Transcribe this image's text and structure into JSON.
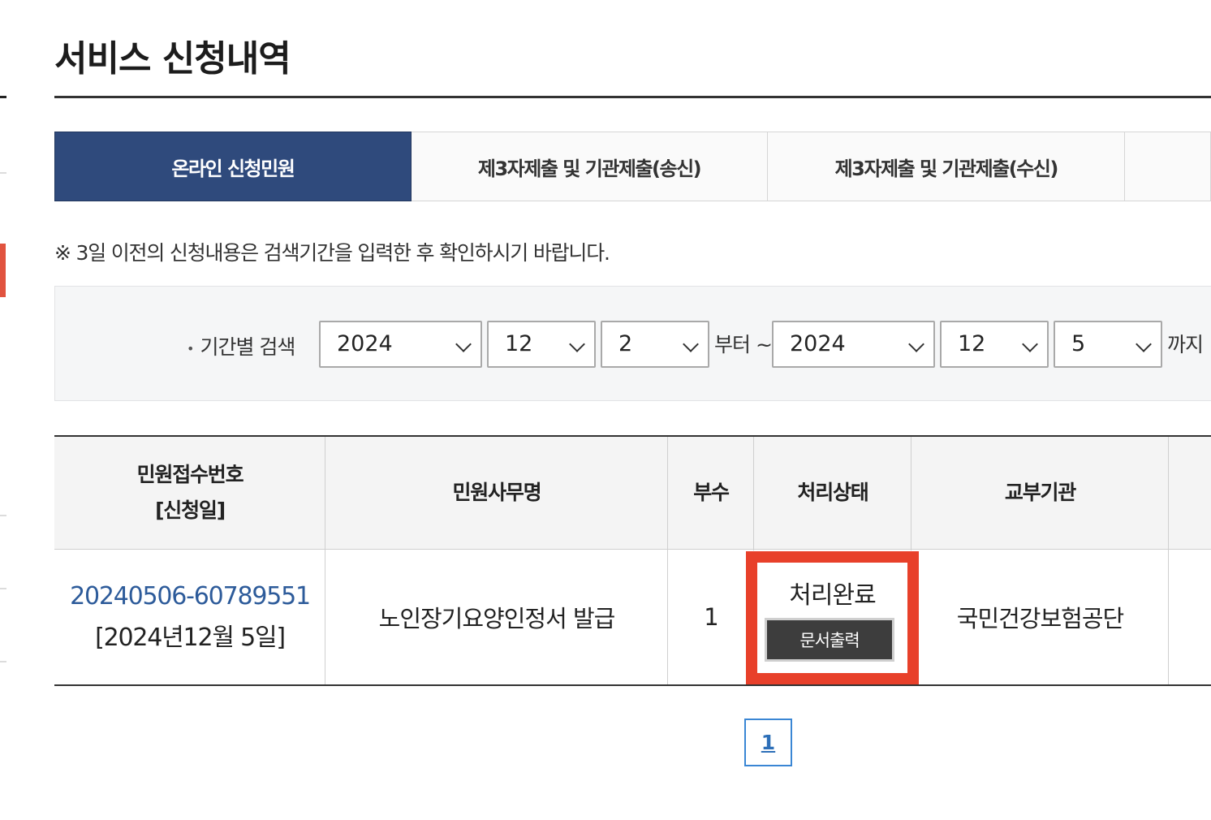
{
  "page": {
    "title": "서비스 신청내역",
    "notice": "※ 3일 이전의 신청내용은 검색기간을 입력한 후 확인하시기 바랍니다."
  },
  "tabs": [
    {
      "label": "온라인 신청민원",
      "active": true
    },
    {
      "label": "제3자제출 및 기관제출(송신)",
      "active": false
    },
    {
      "label": "제3자제출 및 기관제출(수신)",
      "active": false
    }
  ],
  "search": {
    "label": "기간별 검색",
    "from_year": "2024",
    "from_month": "12",
    "from_day": "2",
    "from_word": "부터 ~",
    "to_year": "2024",
    "to_month": "12",
    "to_day": "5",
    "to_word": "까지"
  },
  "table": {
    "headers": {
      "receipt_line1": "민원접수번호",
      "receipt_line2": "[신청일]",
      "service_name": "민원사무명",
      "copies": "부수",
      "status": "처리상태",
      "issuing_agency": "교부기관"
    },
    "rows": [
      {
        "receipt_number": "20240506-60789551",
        "apply_date": "[2024년12월 5일]",
        "service_name": "노인장기요양인정서 발급",
        "copies": "1",
        "status": "처리완료",
        "action_label": "문서출력",
        "issuing_agency": "국민건강보험공단"
      }
    ]
  },
  "pagination": {
    "current_page": "1"
  },
  "colors": {
    "active_tab": "#2f4a7c",
    "link": "#2d5b9a",
    "highlight_border": "#e8402a",
    "print_button": "#3d3d3d"
  }
}
